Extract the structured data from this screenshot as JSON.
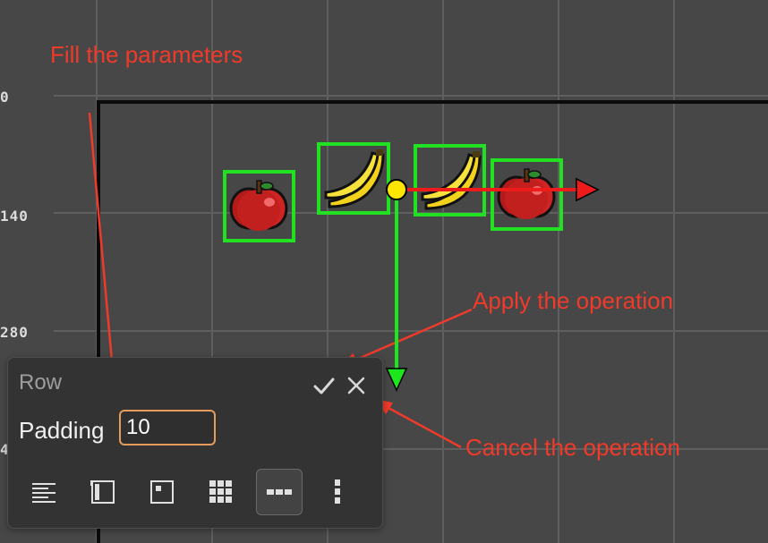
{
  "ruler": {
    "labels": [
      "0",
      "140",
      "280",
      "4"
    ]
  },
  "annotations": {
    "fill_params": "Fill the parameters",
    "apply": "Apply the operation",
    "cancel": "Cancel the operation"
  },
  "sprites": [
    {
      "kind": "apple-icon"
    },
    {
      "kind": "banana-icon"
    },
    {
      "kind": "banana-icon"
    },
    {
      "kind": "apple-icon"
    }
  ],
  "colors": {
    "canvas_bg": "#474747",
    "grid": "#5f5f5f",
    "selection": "#22e022",
    "x_axis_arrow": "#ee1b1b",
    "y_axis_arrow": "#1ee61e",
    "pivot": "#ffe600",
    "annotation": "#f03a2a",
    "input_border": "#e59b5a"
  },
  "panel": {
    "title": "Row",
    "confirm_icon": "check-icon",
    "cancel_icon": "close-icon",
    "padding_label": "Padding",
    "padding_value": "10",
    "tools": [
      {
        "name": "align-left-icon",
        "active": false
      },
      {
        "name": "edge-left-icon",
        "active": false
      },
      {
        "name": "anchor-icon",
        "active": false
      },
      {
        "name": "grid-icon",
        "active": false
      },
      {
        "name": "row-icon",
        "active": true
      },
      {
        "name": "column-icon",
        "active": false
      }
    ]
  }
}
